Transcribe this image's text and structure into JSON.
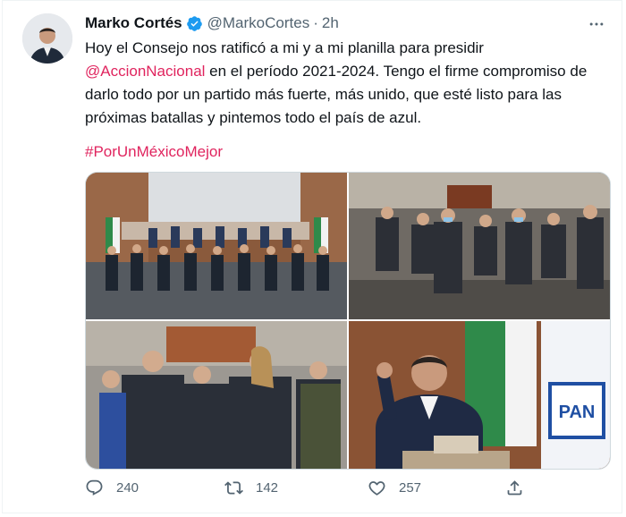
{
  "tweet": {
    "author_name": "Marko Cortés",
    "handle": "@MarkoCortes",
    "separator": "·",
    "time": "2h",
    "text_line1": "Hoy el Consejo nos ratificó a mi y a mi planilla para presidir",
    "mention": "@AccionNacional",
    "text_line2_rest": " en el período 2021-2024. Tengo el firme compromiso de",
    "text_line3": "darlo todo por un partido más fuerte, más unido, que esté listo para las",
    "text_line4": "próximas batallas y pintemos todo el país de azul.",
    "hashtag": "#PorUnMéxicoMejor",
    "party_sign_text": "PAN"
  },
  "actions": {
    "replies": "240",
    "retweets": "142",
    "likes": "257"
  },
  "icons": {
    "verified": "verified-badge-icon",
    "more": "more-options-icon",
    "reply": "reply-icon",
    "retweet": "retweet-icon",
    "like": "heart-icon",
    "share": "share-icon"
  },
  "colors": {
    "accent": "#e0245e",
    "verified": "#1d9bf0",
    "muted": "#536471",
    "text": "#0f1419"
  }
}
